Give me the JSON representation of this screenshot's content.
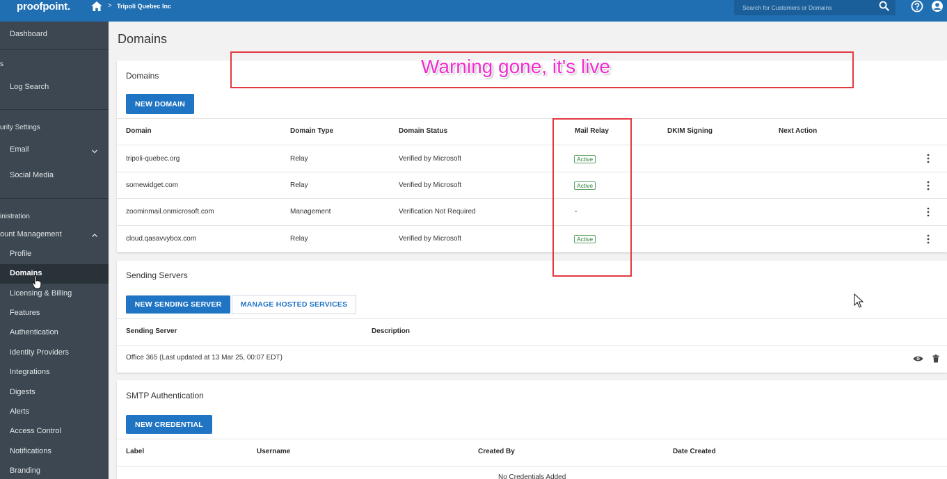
{
  "topbar": {
    "logo": "proofpoint.",
    "breadcrumb_sep": ">",
    "breadcrumb": "Tripoli Quebec Inc",
    "search_placeholder": "Search for Customers or Domains"
  },
  "sidebar": {
    "dashboard": "Dashboard",
    "s_label": "s",
    "log_search": "Log Search",
    "security_settings": "urity Settings",
    "email": "Email",
    "social_media": "Social Media",
    "administration": "inistration",
    "account_management": "ount Management",
    "items": [
      "Profile",
      "Domains",
      "Licensing & Billing",
      "Features",
      "Authentication",
      "Identity Providers",
      "Integrations",
      "Digests",
      "Alerts",
      "Access Control",
      "Notifications",
      "Branding"
    ]
  },
  "page_title": "Domains",
  "domains_card": {
    "title": "Domains",
    "new_button": "NEW DOMAIN",
    "headers": [
      "Domain",
      "Domain Type",
      "Domain Status",
      "Mail Relay",
      "DKIM Signing",
      "Next Action"
    ],
    "rows": [
      {
        "domain": "tripoli-quebec.org",
        "type": "Relay",
        "status": "Verified by Microsoft",
        "relay": "Active"
      },
      {
        "domain": "somewidget.com",
        "type": "Relay",
        "status": "Verified by Microsoft",
        "relay": "Active"
      },
      {
        "domain": "zoominmail.onmicrosoft.com",
        "type": "Management",
        "status": "Verification Not Required",
        "relay": "-"
      },
      {
        "domain": "cloud.qasavvybox.com",
        "type": "Relay",
        "status": "Verified by Microsoft",
        "relay": "Active"
      }
    ]
  },
  "sending_card": {
    "title": "Sending Servers",
    "new_button": "NEW SENDING SERVER",
    "manage_button": "MANAGE HOSTED SERVICES",
    "headers": [
      "Sending Server",
      "Description"
    ],
    "rows": [
      {
        "server": "Office 365 (Last updated at 13 Mar 25, 00:07 EDT)"
      }
    ]
  },
  "smtp_card": {
    "title": "SMTP Authentication",
    "new_button": "NEW CREDENTIAL",
    "headers": [
      "Label",
      "Username",
      "Created By",
      "Date Created"
    ],
    "empty": "No Credentials Added"
  },
  "annotation": {
    "text": "Warning gone, it's live"
  },
  "colors": {
    "topbar": "#1f6fb2",
    "sidebar": "#3c4751",
    "primary": "#1f74c4",
    "annotation": "#e2393f",
    "annotation_text": "#f02ccf"
  }
}
